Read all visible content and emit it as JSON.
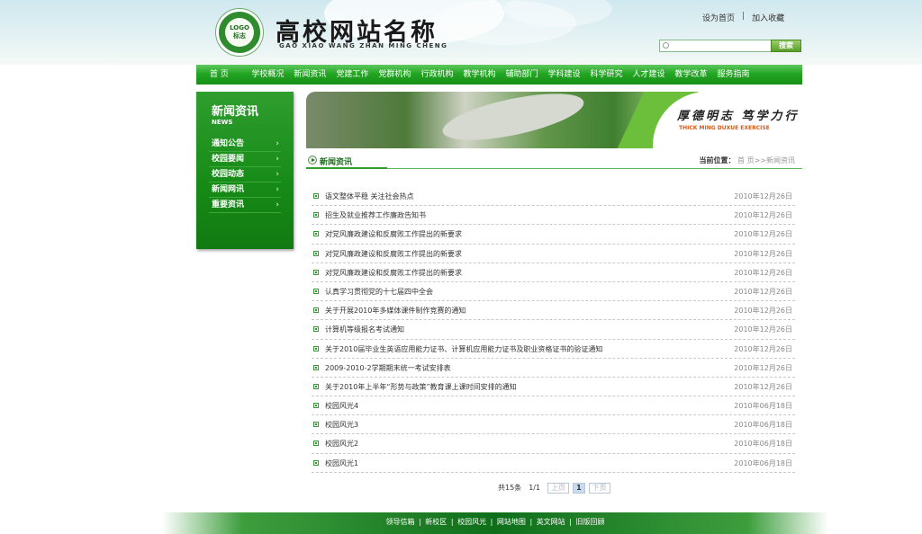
{
  "header": {
    "logo_text": "LOGO",
    "logo_subtext": "标志",
    "site_title": "高校网站名称",
    "site_pinyin": "GAO XIAO WANG ZHAN MING CHENG",
    "top_links": [
      "设为首页",
      "加入收藏"
    ],
    "separator": "|",
    "search_placeholder": "",
    "search_button": "搜索"
  },
  "nav": {
    "items": [
      "首 页",
      "学校概况",
      "新闻资讯",
      "党建工作",
      "党群机构",
      "行政机构",
      "教学机构",
      "辅助部门",
      "学科建设",
      "科学研究",
      "人才建设",
      "教学改革",
      "服务指南"
    ]
  },
  "sidebar": {
    "title": "新闻资讯",
    "subtitle": "NEWS",
    "arrow": "›",
    "items": [
      "通知公告",
      "校园要闻",
      "校园动态",
      "新闻网讯",
      "重要资讯"
    ]
  },
  "banner": {
    "slogan": "厚德明志 笃学力行",
    "slogan_en": "THICK MING DUXUE EXERCISE"
  },
  "section": {
    "title": "新闻资讯",
    "breadcrumb_label": "当前位置：",
    "breadcrumb_path": "首 页>>新闻资讯"
  },
  "news": [
    {
      "title": "语文整体平稳 关注社会热点",
      "date": "2010年12月26日"
    },
    {
      "title": "招生及就业推荐工作廉政告知书",
      "date": "2010年12月26日"
    },
    {
      "title": "对党风廉政建设和反腐败工作提出的新要求",
      "date": "2010年12月26日"
    },
    {
      "title": "对党风廉政建设和反腐败工作提出的新要求",
      "date": "2010年12月26日"
    },
    {
      "title": "对党风廉政建设和反腐败工作提出的新要求",
      "date": "2010年12月26日"
    },
    {
      "title": "认真学习贯彻党的十七届四中全会",
      "date": "2010年12月26日"
    },
    {
      "title": "关于开展2010年多媒体课件制作竞赛的通知",
      "date": "2010年12月26日"
    },
    {
      "title": "计算机等级报名考试通知",
      "date": "2010年12月26日"
    },
    {
      "title": "关于2010届毕业生英语应用能力证书、计算机应用能力证书及职业资格证书的验证通知",
      "date": "2010年12月26日"
    },
    {
      "title": "2009-2010-2学期期末统一考试安排表",
      "date": "2010年12月26日"
    },
    {
      "title": "关于2010年上半年“形势与政策”教育课上课时间安排的通知",
      "date": "2010年12月26日"
    },
    {
      "title": "校园风光4",
      "date": "2010年06月18日"
    },
    {
      "title": "校园风光3",
      "date": "2010年06月18日"
    },
    {
      "title": "校园风光2",
      "date": "2010年06月18日"
    },
    {
      "title": "校园风光1",
      "date": "2010年06月18日"
    }
  ],
  "pager": {
    "total": "共15条",
    "page_info": "1/1",
    "prev": "上页",
    "current": "1",
    "next": "下页"
  },
  "footer": {
    "links": [
      "领导信箱",
      "新校区",
      "校园风光",
      "网站地图",
      "英文网站",
      "旧版回顾"
    ],
    "separator": "|"
  }
}
